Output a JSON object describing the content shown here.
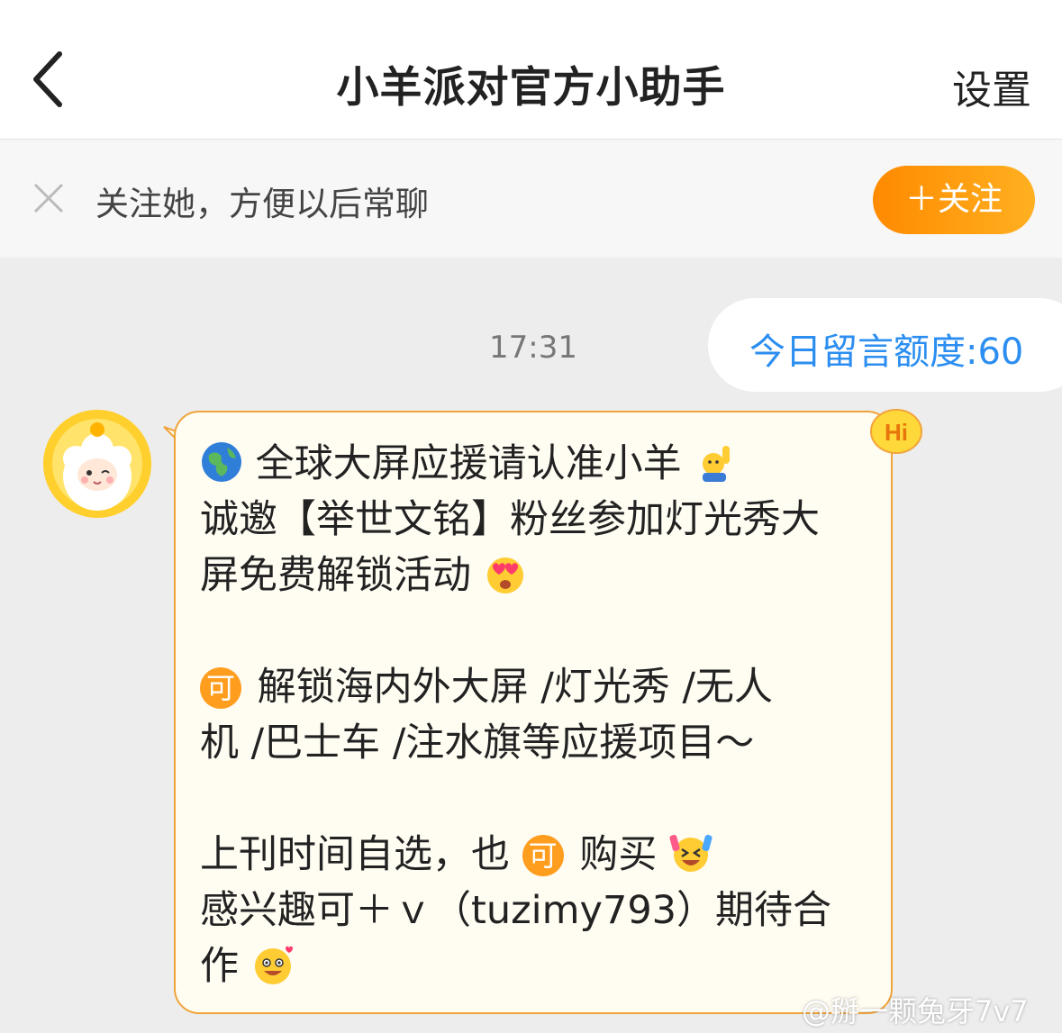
{
  "nav": {
    "title": "小羊派对官方小助手",
    "settings_label": "设置"
  },
  "follow_bar": {
    "text": "关注她，方便以后常聊",
    "button_label": "＋关注"
  },
  "chat": {
    "time": "17:31",
    "quota_text": "今日留言额度:60",
    "message": {
      "line1": "全球大屏应援请认准小羊",
      "line2": "诚邀【举世文铭】粉丝参加灯光秀大",
      "line3": "屏免费解锁活动",
      "line4": "解锁海内外大屏 /灯光秀 /无人",
      "line5": "机 /巴士车 /注水旗等应援项目～",
      "line6a": "上刊时间自选，也",
      "line6b": "购买",
      "line7": "感兴趣可＋ｖ（tuzimy793）期待合",
      "line8": "作",
      "ke_badge": "可"
    },
    "hi_badge": "Hi"
  },
  "watermark": "@掰一颗兔牙7v7",
  "colors": {
    "accent_orange": "#ff9d1e",
    "quota_blue": "#2b8ef0",
    "bubble_border": "#f0a43a",
    "bubble_bg": "#fffcf2"
  },
  "icons": [
    "back-chevron-icon",
    "close-icon",
    "globe-emoji-icon",
    "raised-hand-emoji-icon",
    "heart-eyes-emoji-icon",
    "laugh-emoji-icon",
    "grin-emoji-icon",
    "hi-badge-icon",
    "avatar-sheep"
  ]
}
